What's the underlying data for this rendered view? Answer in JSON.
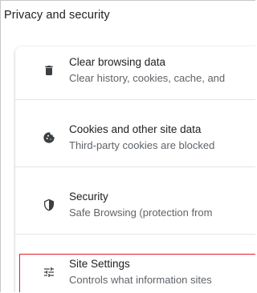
{
  "section": {
    "title": "Privacy and security"
  },
  "items": [
    {
      "icon": "trash-icon",
      "title": "Clear browsing data",
      "description": "Clear history, cookies, cache, and"
    },
    {
      "icon": "cookie-icon",
      "title": "Cookies and other site data",
      "description": "Third-party cookies are blocked"
    },
    {
      "icon": "shield-icon",
      "title": "Security",
      "description": "Safe Browsing (protection from"
    },
    {
      "icon": "tune-icon",
      "title": "Site Settings",
      "description": "Controls what information sites"
    }
  ],
  "colors": {
    "highlight_border": "#e0202c",
    "icon": "#3c4043",
    "title_text": "#202124",
    "description_text": "#5f6368"
  }
}
